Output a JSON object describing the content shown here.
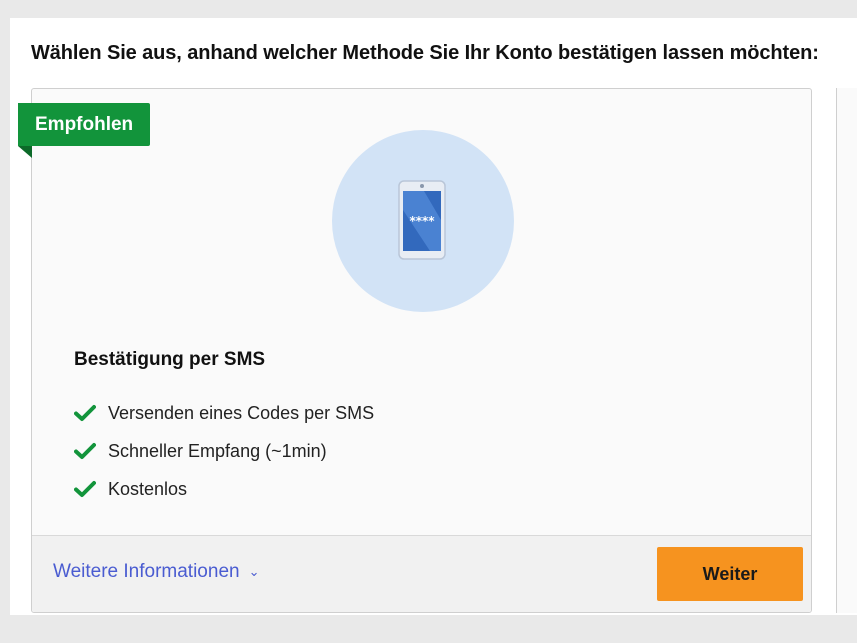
{
  "heading": "Wählen Sie aus, anhand welcher Methode Sie Ihr Konto bestätigen lassen möchten:",
  "card": {
    "ribbon_label": "Empfohlen",
    "illustration": "phone-icon",
    "screen_text": "****",
    "title": "Bestätigung per SMS",
    "features": [
      "Versenden eines Codes per SMS",
      "Schneller Empfang (~1min)",
      "Kostenlos"
    ],
    "more_info_label": "Weitere Informationen",
    "more_info_icon": "chevron-down-icon",
    "next_label": "Weiter"
  },
  "colors": {
    "ribbon": "#12943b",
    "checkmark": "#12943b",
    "link": "#4a5cd1",
    "primary_button": "#f6931f",
    "circle": "#d2e3f6"
  }
}
